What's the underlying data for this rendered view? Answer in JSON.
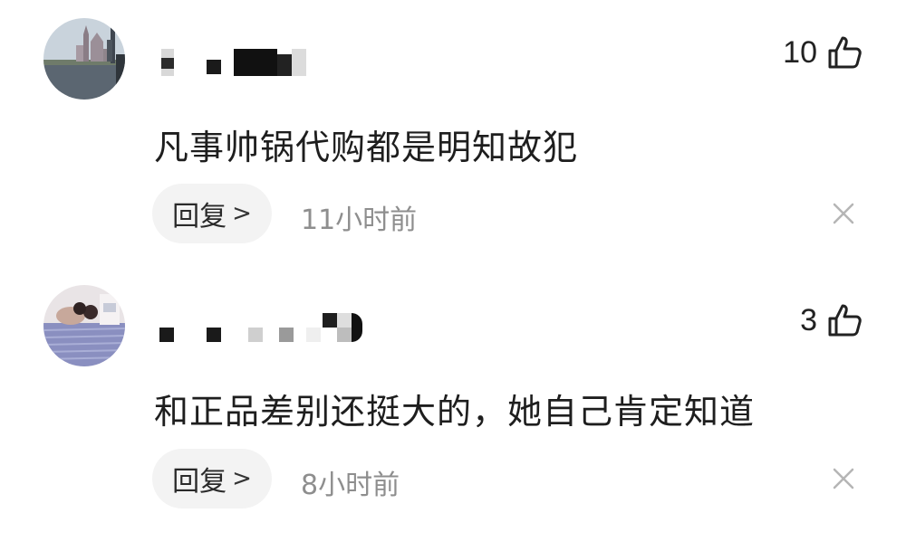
{
  "comments": [
    {
      "likes": "10",
      "text": "凡事帅锅代购都是明知故犯",
      "reply_label": "回复",
      "reply_chevron": ">",
      "time": "11小时前",
      "avatar_icon": "castle-lake-photo-avatar",
      "username_obscured": true
    },
    {
      "likes": "3",
      "text": "和正品差别还挺大的，她自己肯定知道",
      "reply_label": "回复",
      "reply_chevron": ">",
      "time": "8小时前",
      "avatar_icon": "person-photo-avatar",
      "username_obscured": true
    }
  ],
  "colors": {
    "background": "#ffffff",
    "reply_button_bg": "#f3f3f3",
    "time_text": "#8e8e8e",
    "close_icon": "#b5b5b5"
  }
}
